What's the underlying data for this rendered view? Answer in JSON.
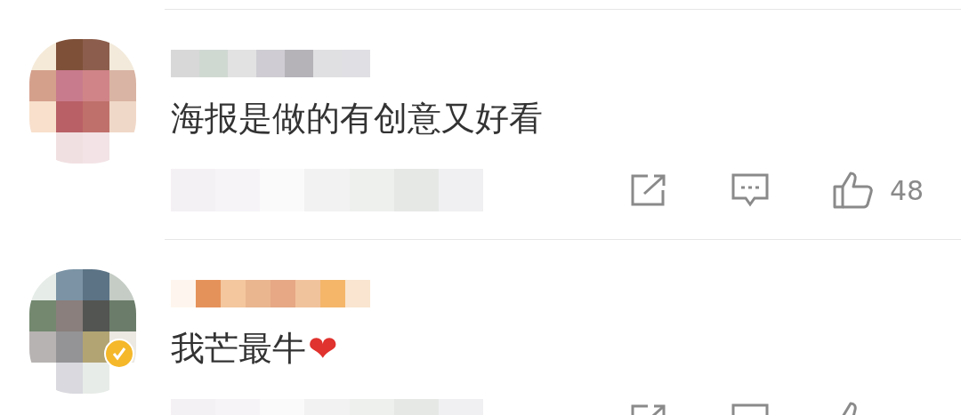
{
  "comments": [
    {
      "text": "海报是做的有创意又好看",
      "verified": false,
      "likes": "48"
    },
    {
      "text": "我芒最牛",
      "emoji": "❤",
      "verified": true
    }
  ]
}
